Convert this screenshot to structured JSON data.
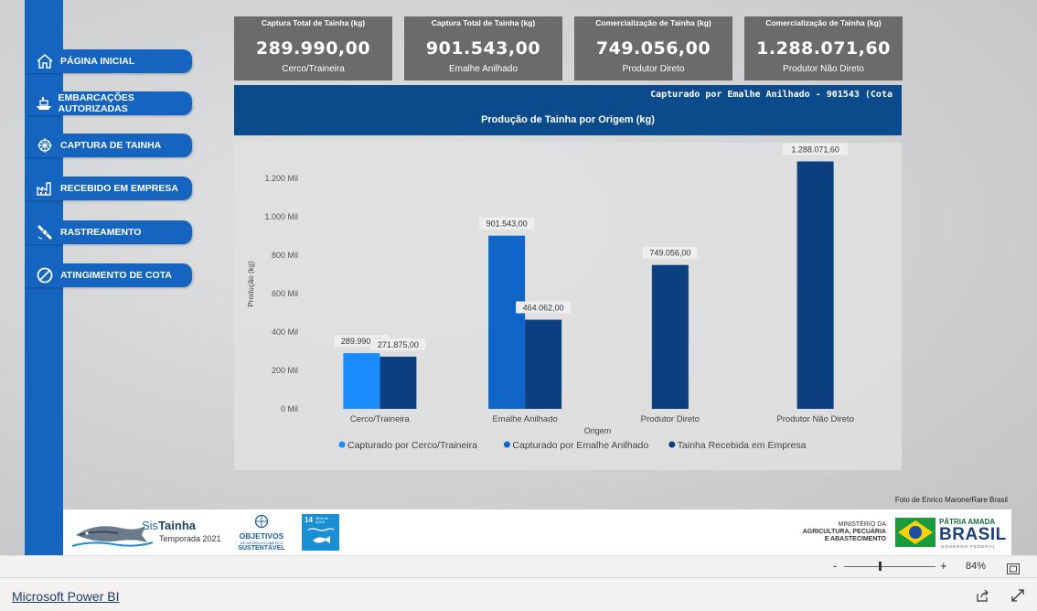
{
  "nav": {
    "items": [
      {
        "label": "PÁGINA INICIAL",
        "icon": "home-icon"
      },
      {
        "label": "EMBARCAÇÕES AUTORIZADAS",
        "icon": "boat-icon"
      },
      {
        "label": "CAPTURA DE TAINHA",
        "icon": "fishing-net-icon"
      },
      {
        "label": "RECEBIDO EM EMPRESA",
        "icon": "factory-icon"
      },
      {
        "label": "RASTREAMENTO",
        "icon": "satellite-icon"
      },
      {
        "label": "ATINGIMENTO DE COTA",
        "icon": "ban-icon"
      }
    ]
  },
  "cards": [
    {
      "title": "Captura Total de Tainha (kg)",
      "value": "289.990,00",
      "subtitle": "Cerco/Traineira"
    },
    {
      "title": "Captura Total de Tainha (kg)",
      "value": "901.543,00",
      "subtitle": "Emalhe Anilhado"
    },
    {
      "title": "Comercialização de Tainha (kg)",
      "value": "749.056,00",
      "subtitle": "Produtor Direto"
    },
    {
      "title": "Comercialização de Tainha (kg)",
      "value": "1.288.071,60",
      "subtitle": "Produtor Não Direto"
    }
  ],
  "ticker": {
    "text": "Capturado por Emalhe Anilhado - 901543 (Cota"
  },
  "chart_data": {
    "type": "bar",
    "title": "Produção de Tainha por Origem (kg)",
    "xlabel": "Origem",
    "ylabel": "Produção (kg)",
    "ylim": [
      0,
      1300000
    ],
    "yticks": [
      {
        "value": 0,
        "label": "0 Mil"
      },
      {
        "value": 200000,
        "label": "200 Mil"
      },
      {
        "value": 400000,
        "label": "400 Mil"
      },
      {
        "value": 600000,
        "label": "600 Mil"
      },
      {
        "value": 800000,
        "label": "800 Mil"
      },
      {
        "value": 1000000,
        "label": "1.000 Mil"
      },
      {
        "value": 1200000,
        "label": "1.200 Mil"
      }
    ],
    "categories": [
      "Cerco/Traineira",
      "Emalhe Anilhado",
      "Produtor Direto",
      "Produtor Não Direto"
    ],
    "series": [
      {
        "name": "Capturado por Cerco/Traineira",
        "color": "#1a8cff",
        "values": [
          289990,
          null,
          null,
          null
        ],
        "labels": [
          "289.990,00",
          null,
          null,
          null
        ]
      },
      {
        "name": "Capturado por Emalhe Anilhado",
        "color": "#0f66c8",
        "values": [
          null,
          901543,
          null,
          null
        ],
        "labels": [
          null,
          "901.543,00",
          null,
          null
        ]
      },
      {
        "name": "Tainha Recebida em Empresa",
        "color": "#0b3f7f",
        "values": [
          271875,
          464062,
          749056,
          1288071.6
        ],
        "labels": [
          "271.875,00",
          "464.062,00",
          "749.056,00",
          "1.288.071,60"
        ]
      }
    ],
    "legend_position": "bottom",
    "grid": false
  },
  "credit": "Foto de Enrico Marone/Rare Brasil",
  "footer": {
    "sis_prefix": "Sis",
    "sis_name": "Tainha",
    "season": "Temporada 2021",
    "ods_line1": "OBJETIVOS",
    "ods_line2": "DE DESENVOLVIMENTO",
    "ods_line3": "SUSTENTÁVEL",
    "ods14_number": "14",
    "ods14_text": "VIDA NA ÁGUA",
    "ministry_line1": "MINISTÉRIO DA",
    "ministry_line2": "AGRICULTURA, PECUÁRIA",
    "ministry_line3": "E ABASTECIMENTO",
    "brasil_top": "PÁTRIA AMADA",
    "brasil_main": "BRASIL",
    "brasil_bottom": "GOVERNO FEDERAL"
  },
  "zoom": {
    "minus": "-",
    "plus": "+",
    "value": "84%"
  },
  "app": {
    "link": "Microsoft Power BI"
  }
}
